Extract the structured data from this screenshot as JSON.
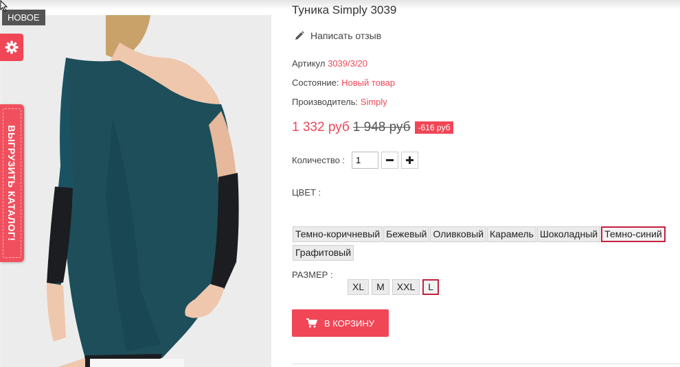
{
  "badges": {
    "new": "НОВОЕ"
  },
  "sidebar": {
    "catalog_tab": "ВЫГРУЗИТЬ КАТАЛОГ!"
  },
  "product": {
    "title": "Туника Simply 3039",
    "review_link": "Написать отзыв",
    "article_label": "Артикул",
    "article_value": "3039/3/20",
    "condition_label": "Состояние:",
    "condition_value": "Новый товар",
    "manufacturer_label": "Производитель:",
    "manufacturer_value": "Simply",
    "price_new": "1 332 руб",
    "price_old": "1 948 руб",
    "discount": "-616 руб",
    "quantity_label": "Количество :",
    "quantity_value": "1",
    "color_label": "ЦВЕТ :",
    "colors": [
      "Темно-коричневый",
      "Бежевый",
      "Оливковый",
      "Карамель",
      "Шоколадный",
      "Темно-синий",
      "Графитовый"
    ],
    "color_selected": "Темно-синий",
    "size_label": "РАЗМЕР :",
    "sizes": [
      "XL",
      "M",
      "XXL",
      "L"
    ],
    "size_selected": "L",
    "cart_button": "В КОРЗИНУ"
  },
  "icons": {
    "settings": "gear-icon",
    "review": "pencil-icon",
    "minus": "minus-icon",
    "plus": "plus-icon",
    "cart": "cart-icon"
  },
  "colors_theme": {
    "accent": "#f04656",
    "selected_border": "#c51f3e"
  }
}
